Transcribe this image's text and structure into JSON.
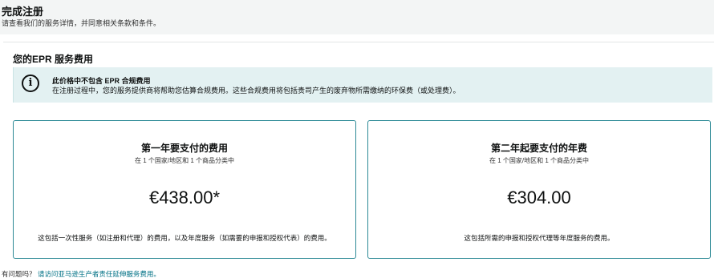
{
  "header": {
    "title": "完成注册",
    "subtitle": "请查看我们的服务详情，并同意相关条款和条件。"
  },
  "fees": {
    "section_title": "您的EPR 服务费用",
    "info": {
      "icon": "info-icon",
      "title": "此价格中不包含 EPR 合规费用",
      "text": "在注册过程中，您的服务提供商将帮助您估算合规费用。这些合规费用将包括贵司产生的废弃物所需缴纳的环保费（或处理费）。"
    },
    "cards": [
      {
        "title": "第一年要支付的费用",
        "subtitle": "在 1 个国家/地区和 1 个商品分类中",
        "price": "€438.00*",
        "description": "这包括一次性服务（如注册和代理）的费用，以及年度服务（如需要的申报和授权代表）的费用。"
      },
      {
        "title": "第二年起要支付的年费",
        "subtitle": "在 1 个国家/地区和 1 个商品分类中",
        "price": "€304.00",
        "description": "这包括所需的申报和授权代理等年度服务的费用。"
      }
    ]
  },
  "footer": {
    "question": "有问题吗？",
    "link": "请访问亚马逊生产者责任延伸服务费用。"
  },
  "colors": {
    "accent": "#2d8a96",
    "info_bg": "#e3f1f2",
    "link": "#007185"
  }
}
